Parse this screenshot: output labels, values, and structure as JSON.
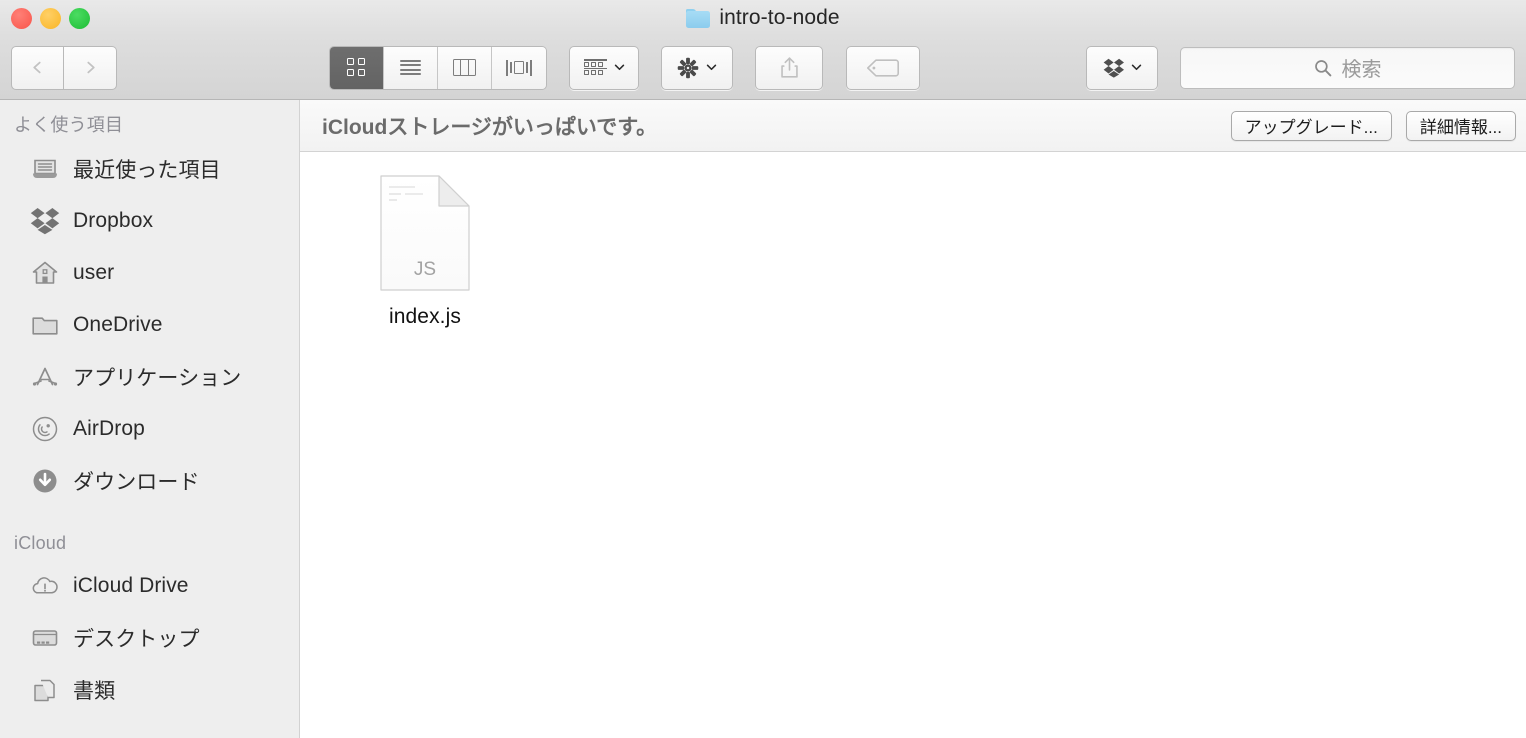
{
  "window": {
    "title": "intro-to-node",
    "title_icon": "folder-icon",
    "controls": {
      "close": "close-button",
      "minimize": "minimize-button",
      "maximize": "maximize-button"
    },
    "colors": {
      "close": "#f9554a",
      "minimize": "#f9b526",
      "maximize": "#1dbd34",
      "titlebar": "#dedede",
      "toolbar": "#d4d4d4",
      "sidebar": "#eeeeee",
      "content": "#ffffff",
      "active_segment": "#6e6e6e",
      "folder_blue": "#8bcced"
    }
  },
  "toolbar": {
    "nav": {
      "back_label": "back-button",
      "forward_label": "forward-button",
      "back_enabled": false,
      "forward_enabled": false
    },
    "view_modes": [
      {
        "name": "icon-view",
        "active": true
      },
      {
        "name": "list-view",
        "active": false
      },
      {
        "name": "column-view",
        "active": false
      },
      {
        "name": "coverflow-view",
        "active": false
      }
    ],
    "arrange": {
      "icon": "arrange-icon",
      "chevron": "chevron-down-icon"
    },
    "action": {
      "icon": "gear-icon",
      "chevron": "chevron-down-icon"
    },
    "share": {
      "icon": "share-icon"
    },
    "tags": {
      "icon": "tag-icon"
    },
    "dropbox": {
      "icon": "dropbox-icon",
      "chevron": "chevron-down-icon"
    },
    "search": {
      "icon": "search-icon",
      "placeholder": "検索",
      "value": ""
    }
  },
  "sidebar": {
    "sections": [
      {
        "header": "よく使う項目",
        "items": [
          {
            "label": "最近使った項目",
            "icon": "recents-icon"
          },
          {
            "label": "Dropbox",
            "icon": "dropbox-icon"
          },
          {
            "label": "user",
            "icon": "home-icon"
          },
          {
            "label": "OneDrive",
            "icon": "folder-icon"
          },
          {
            "label": "アプリケーション",
            "icon": "applications-icon"
          },
          {
            "label": "AirDrop",
            "icon": "airdrop-icon"
          },
          {
            "label": "ダウンロード",
            "icon": "downloads-icon"
          }
        ]
      },
      {
        "header": "iCloud",
        "items": [
          {
            "label": "iCloud Drive",
            "icon": "icloud-warning-icon"
          },
          {
            "label": "デスクトップ",
            "icon": "desktop-icon"
          },
          {
            "label": "書類",
            "icon": "documents-icon"
          }
        ]
      }
    ]
  },
  "notice": {
    "message": "iCloudストレージがいっぱいです。",
    "upgrade_label": "アップグレード...",
    "details_label": "詳細情報..."
  },
  "files": [
    {
      "name": "index.js",
      "icon": "js-document-icon",
      "badge": "JS",
      "selected": false
    }
  ]
}
